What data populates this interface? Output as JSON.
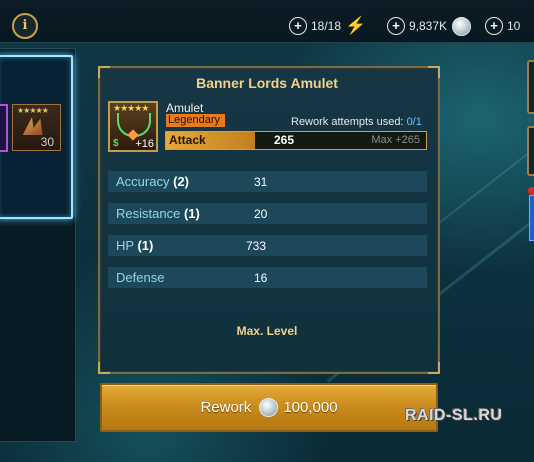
{
  "topbar": {
    "info_label": "i",
    "energy": "18/18",
    "silver": "9,837K",
    "gems": "10"
  },
  "inventory": {
    "selected_level": "30"
  },
  "artifact": {
    "name": "Banner Lords Amulet",
    "type": "Amulet",
    "rarity": "Legendary",
    "level_badge": "+16",
    "rework_attempts_label": "Rework attempts used:",
    "rework_attempts_value": "0/1",
    "main_stat": {
      "name": "Attack",
      "value": "265",
      "max": "Max +265"
    },
    "substats": [
      {
        "name": "Accuracy",
        "rolls": "(2)",
        "value": "31"
      },
      {
        "name": "Resistance",
        "rolls": "(1)",
        "value": "20"
      },
      {
        "name": "HP",
        "rolls": "(1)",
        "value": "733"
      },
      {
        "name": "Defense",
        "rolls": "",
        "value": "16"
      }
    ],
    "max_level_label": "Max. Level"
  },
  "rework_button": {
    "label": "Rework",
    "cost": "100,000"
  },
  "watermark": "RAID-SL.RU",
  "colors": {
    "accent_gold": "#f0d38b",
    "rarity_legendary": "#e57a1f",
    "substat_name": "#8fd8ee",
    "rework_attempts_value": "#6ec5ff"
  },
  "icons": {
    "info": "info-icon",
    "energy": "lightning-icon",
    "silver": "silver-coin-icon",
    "artifact": "amulet-icon"
  }
}
